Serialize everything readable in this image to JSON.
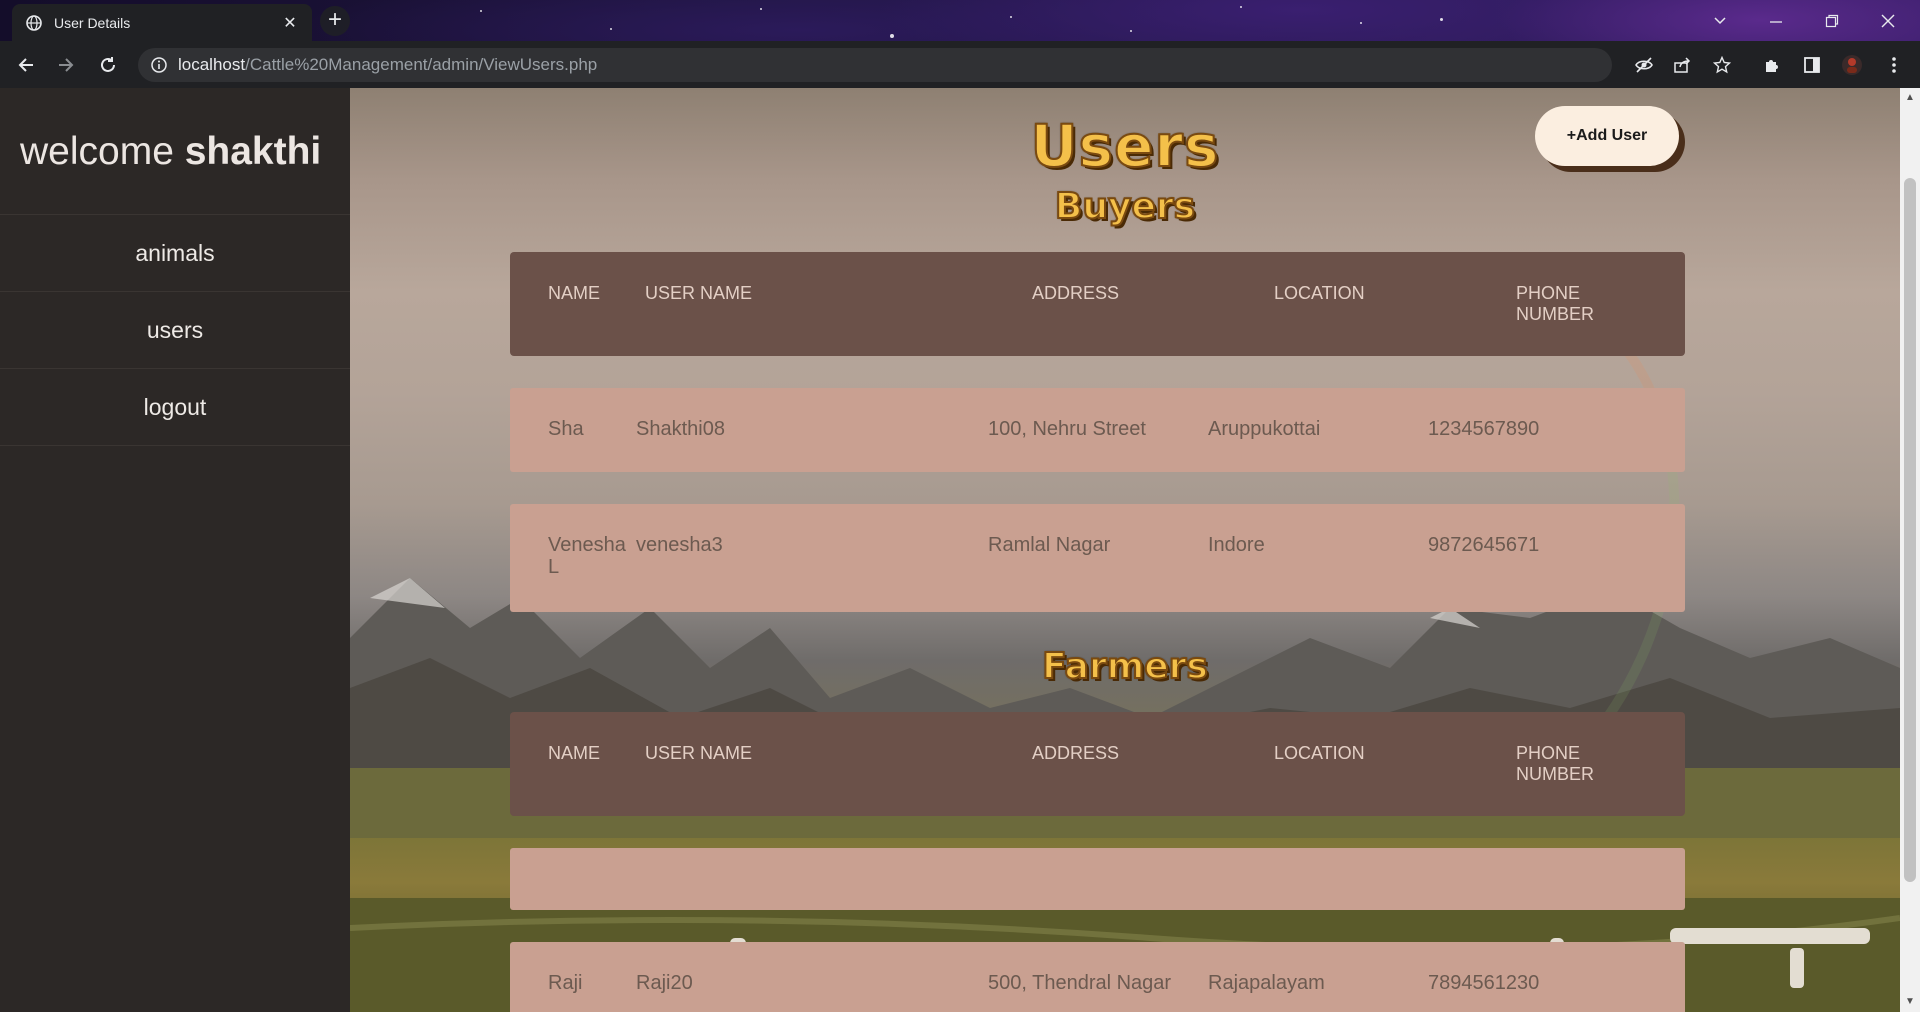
{
  "browser": {
    "tab_title": "User Details",
    "tab_close": "✕",
    "new_tab": "+",
    "url_host": "localhost",
    "url_path": "/Cattle%20Management/admin/ViewUsers.php"
  },
  "sidebar": {
    "welcome_prefix": "welcome",
    "username": "shakthi",
    "items": [
      {
        "label": "animals"
      },
      {
        "label": "users"
      },
      {
        "label": "logout"
      }
    ]
  },
  "main": {
    "title": "Users",
    "add_user_label": "+Add User",
    "buyers": {
      "heading": "Buyers",
      "columns": [
        "NAME",
        "USER NAME",
        "ADDRESS",
        "LOCATION",
        "PHONE NUMBER"
      ],
      "rows": [
        {
          "name": "Sha",
          "username": "Shakthi08",
          "address": "100, Nehru Street",
          "location": "Aruppukottai",
          "phone": "1234567890"
        },
        {
          "name": "Venesha L",
          "username": "venesha3",
          "address": "Ramlal Nagar",
          "location": "Indore",
          "phone": "9872645671"
        }
      ]
    },
    "farmers": {
      "heading": "Farmers",
      "columns": [
        "NAME",
        "USER NAME",
        "ADDRESS",
        "LOCATION",
        "PHONE NUMBER"
      ],
      "rows": [
        {
          "name": "",
          "username": "",
          "address": "",
          "location": "",
          "phone": ""
        },
        {
          "name": "Raji",
          "username": "Raji20",
          "address": "500, Thendral Nagar",
          "location": "Rajapalayam",
          "phone": "7894561230"
        }
      ]
    }
  },
  "colors": {
    "sidebar_bg": "#2c2826",
    "header_bg": "#6b5149",
    "row_bg": "#c9a091",
    "heading_gold": "#f4c04a",
    "button_bg": "#fbeee0"
  }
}
